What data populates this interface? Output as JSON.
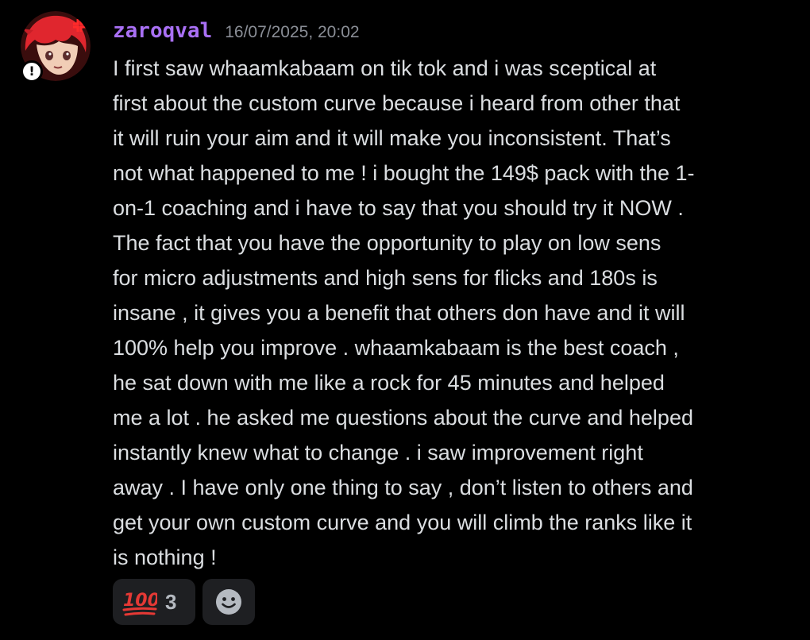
{
  "message": {
    "username": "zaroqval",
    "timestamp": "16/07/2025, 20:02",
    "badge": "!",
    "lines": [
      "I first saw whaamkabaam on tik tok and i was sceptical at",
      "first about the custom curve because i heard from other that",
      "it will ruin your aim and it will make you inconsistent. That’s",
      "not what happened to me ! i bought the 149$ pack with the 1-",
      "on-1 coaching and i have to say that you should try it NOW .",
      "The fact that you have the opportunity to play on low sens",
      "for micro adjustments and high sens for flicks and 180s is",
      "insane , it gives you a benefit that others don have and it will",
      "100% help you improve . whaamkabaam is the best coach  ,",
      "he sat down with me like a rock for 45 minutes and helped",
      "me a lot . he asked me questions about the curve and helped",
      "instantly knew what to change . i saw improvement right",
      "away . I have only one thing to say , don’t listen to others and",
      "get your own custom curve and you will climb the ranks like it",
      "is nothing !"
    ]
  },
  "reactions": [
    {
      "emoji": "hundred-points-icon",
      "count": "3"
    },
    {
      "emoji": "add-reaction-smile-icon"
    }
  ],
  "colors": {
    "background": "#000000",
    "username": "#a970f5",
    "timestamp": "#8a8e96",
    "text": "#dbdee1",
    "reaction_bg": "#1e1f22",
    "hundred_red": "#e53935"
  }
}
